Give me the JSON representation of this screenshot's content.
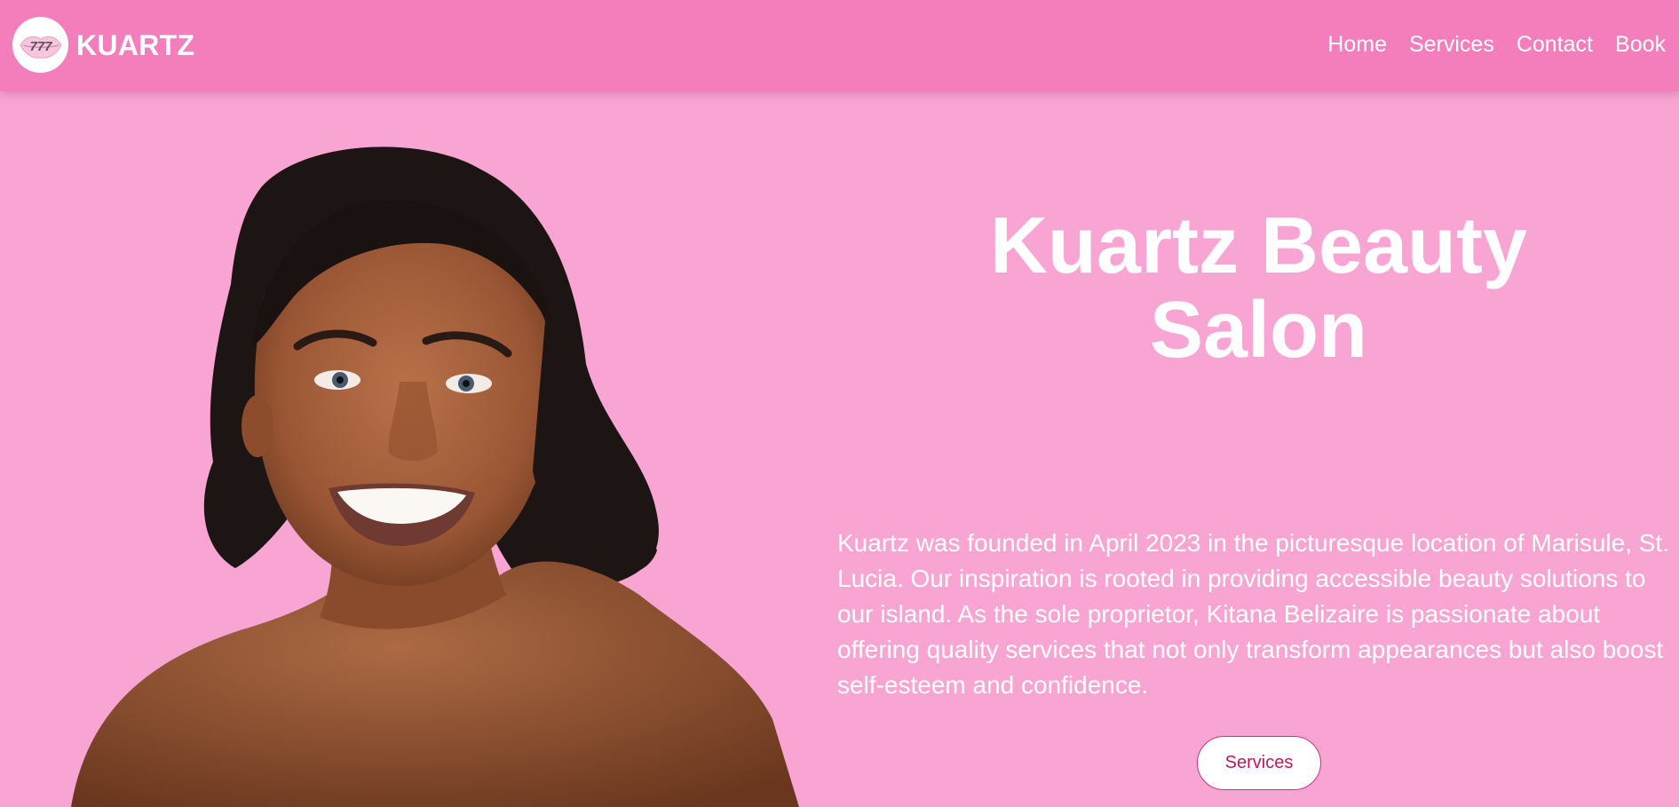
{
  "header": {
    "logo_icon": "lips-logo-icon",
    "logo_text": "777",
    "brand": "KUARTZ",
    "nav": [
      {
        "label": "Home"
      },
      {
        "label": "Services"
      },
      {
        "label": "Contact"
      },
      {
        "label": "Book"
      }
    ]
  },
  "hero": {
    "image": "smiling-woman-portrait",
    "title": "Kuartz Beauty Salon",
    "description": "Kuartz was founded in April 2023 in the picturesque location of Marisule, St. Lucia. Our inspiration is rooted in providing accessible beauty solutions to our island. As the sole proprietor, Kitana Belizaire is passionate about offering quality services that not only transform appearances but also boost self-esteem and confidence.",
    "button_label": "Services"
  },
  "colors": {
    "header_bg": "#f47ebb",
    "page_bg": "#f8a5d4",
    "text": "#ffffff",
    "button_text": "#c2185b"
  }
}
